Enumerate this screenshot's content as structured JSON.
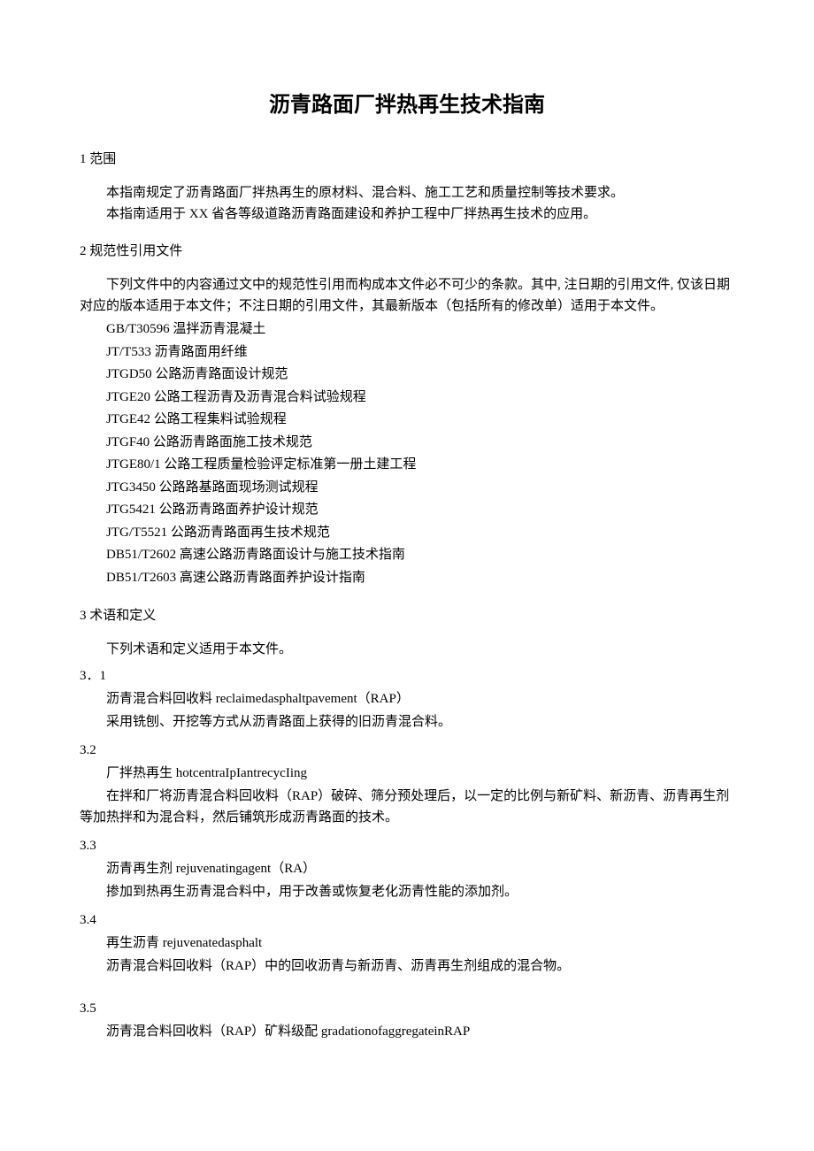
{
  "title": "沥青路面厂拌热再生技术指南",
  "s1": {
    "heading": "1 范围",
    "p1": "本指南规定了沥青路面厂拌热再生的原材料、混合料、施工工艺和质量控制等技术要求。",
    "p2": "本指南适用于 XX 省各等级道路沥青路面建设和养护工程中厂拌热再生技术的应用。"
  },
  "s2": {
    "heading": "2 规范性引用文件",
    "p1": "下列文件中的内容通过文中的规范性引用而构成本文件必不可少的条款。其中, 注日期的引用文件, 仅该日期对应的版本适用于本文件；不注日期的引用文件，其最新版本（包括所有的修改单）适用于本文件。",
    "refs": [
      "GB/T30596 温拌沥青混凝土",
      "JT/T533 沥青路面用纤维",
      "JTGD50 公路沥青路面设计规范",
      "JTGE20 公路工程沥青及沥青混合料试验规程",
      "JTGE42 公路工程集料试验规程",
      "JTGF40 公路沥青路面施工技术规范",
      "JTGE80/1 公路工程质量检验评定标准第一册土建工程",
      "JTG3450 公路路基路面现场测试规程",
      "JTG5421 公路沥青路面养护设计规范",
      "JTG/T5521 公路沥青路面再生技术规范",
      "DB51/T2602 高速公路沥青路面设计与施工技术指南",
      "DB51/T2603 高速公路沥青路面养护设计指南"
    ]
  },
  "s3": {
    "heading": "3 术语和定义",
    "intro": "下列术语和定义适用于本文件。",
    "d1": {
      "num": "3．1",
      "term": "沥青混合料回收料 reclaimedasphaltpavement（RAP）",
      "desc": "采用铣刨、开挖等方式从沥青路面上获得的旧沥青混合料。"
    },
    "d2": {
      "num": "3.2",
      "term": "厂拌热再生 hotcentraIpIantrecycIing",
      "desc": "在拌和厂将沥青混合料回收料（RAP）破碎、筛分预处理后，以一定的比例与新矿料、新沥青、沥青再生剂等加热拌和为混合料，然后铺筑形成沥青路面的技术。"
    },
    "d3": {
      "num": "3.3",
      "term": "沥青再生剂 rejuvenatingagent（RA）",
      "desc": "掺加到热再生沥青混合料中，用于改善或恢复老化沥青性能的添加剂。"
    },
    "d4": {
      "num": "3.4",
      "term": "再生沥青 rejuvenatedasphalt",
      "desc": "沥青混合料回收料（RAP）中的回收沥青与新沥青、沥青再生剂组成的混合物。"
    },
    "d5": {
      "num": "3.5",
      "term": "沥青混合料回收料（RAP）矿料级配 gradationofaggregateinRAP"
    }
  }
}
